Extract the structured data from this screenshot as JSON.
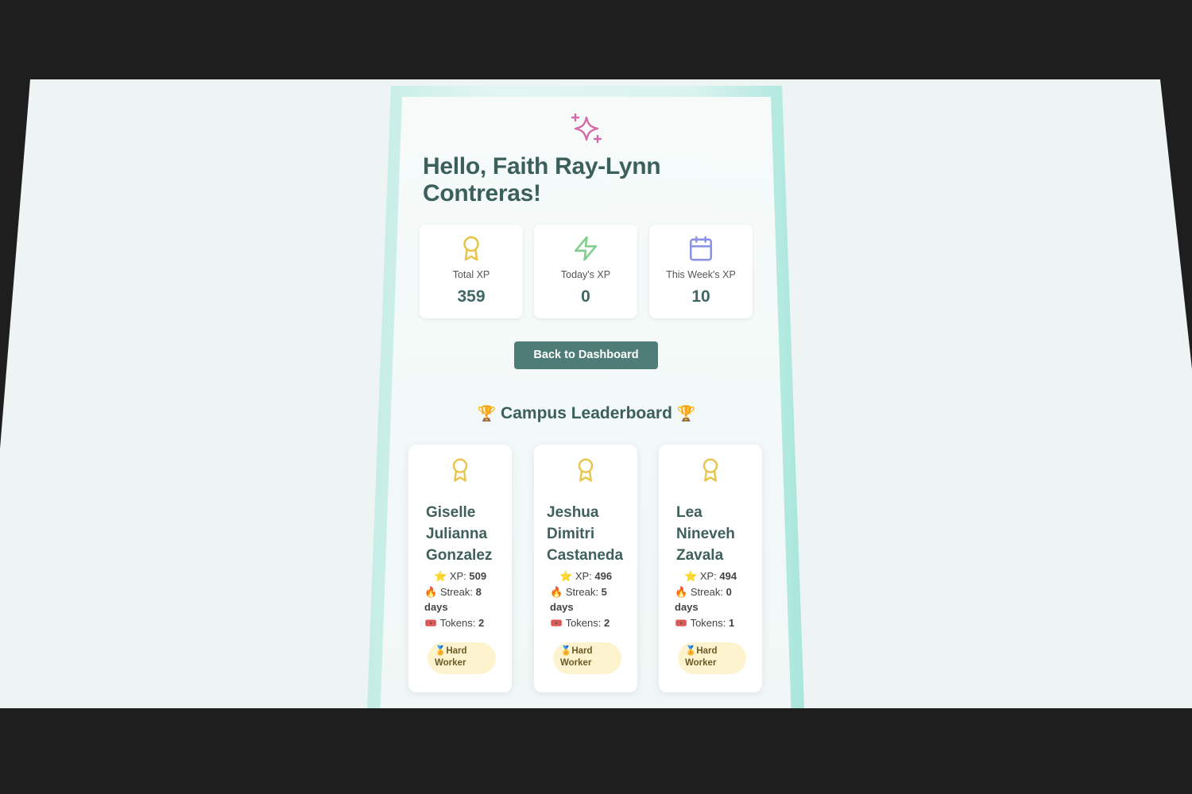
{
  "greeting": "Hello, Faith Ray-Lynn Contreras!",
  "stats": [
    {
      "label": "Total XP",
      "value": "359",
      "icon": "award-icon",
      "color": "#e8c44a"
    },
    {
      "label": "Today's XP",
      "value": "0",
      "icon": "lightning-icon",
      "color": "#7fcf8c"
    },
    {
      "label": "This Week's XP",
      "value": "10",
      "icon": "calendar-icon",
      "color": "#8b93e6"
    }
  ],
  "back_button": "Back to Dashboard",
  "leaderboard": {
    "title": "Campus Leaderboard",
    "trophy": "🏆",
    "xp_label": "XP:",
    "streak_label": "Streak:",
    "tokens_label": "Tokens:",
    "star_emoji": "⭐",
    "fire_emoji": "🔥",
    "ticket_emoji": "🎟️",
    "medal_emoji": "🏅",
    "players": [
      {
        "name": "Giselle Julianna Gonzalez",
        "xp": "509",
        "streak": "8",
        "streak_unit": "days",
        "tokens": "2",
        "badge": "Hard Worker"
      },
      {
        "name": "Jeshua Dimitri Castaneda",
        "xp": "496",
        "streak": "5",
        "streak_unit": "days",
        "tokens": "2",
        "badge": "Hard Worker"
      },
      {
        "name": "Lea Nineveh Zavala",
        "xp": "494",
        "streak": "0",
        "streak_unit": "days",
        "tokens": "1",
        "badge": "Hard Worker"
      }
    ]
  },
  "colors": {
    "accent": "#4e7d78",
    "heading": "#3b5f5b",
    "sparkle": "#d46aa8",
    "badge_bg": "#fdf4cf"
  }
}
